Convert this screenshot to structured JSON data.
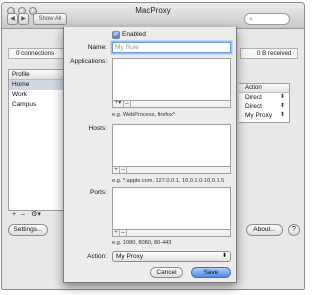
{
  "window": {
    "title": "MacProxy",
    "show_all_label": "Show All",
    "connections_text": "0 connections",
    "received_text": "0 B received",
    "profile": {
      "header": "Profile",
      "items": [
        "Home",
        "Work",
        "Campus"
      ],
      "selected": "Home"
    },
    "profile_add": "+",
    "profile_remove": "–",
    "profile_gear": "⚙▾",
    "rules": {
      "header": "Action",
      "rows": [
        "Direct",
        "Direct",
        "My Proxy"
      ]
    },
    "settings_label": "Settings...",
    "about_label": "About...",
    "help_label": "?"
  },
  "sheet": {
    "enabled_label": "Enabled",
    "name_label": "Name:",
    "name_value": "My Rule",
    "applications_label": "Applications:",
    "applications_hint": "e.g. WebProcess, firefox*",
    "hosts_label": "Hosts:",
    "hosts_hint": "e.g. *.apple.com, 127.0.0.1, 10.0.1.0-10.0.1.5",
    "ports_label": "Ports:",
    "ports_hint": "e.g. 1080, 8080, 80-443",
    "add_label": "+",
    "remove_label": "–",
    "gear_label": "▾",
    "action_label": "Action:",
    "action_value": "My Proxy",
    "cancel_label": "Cancel",
    "save_label": "Save"
  }
}
